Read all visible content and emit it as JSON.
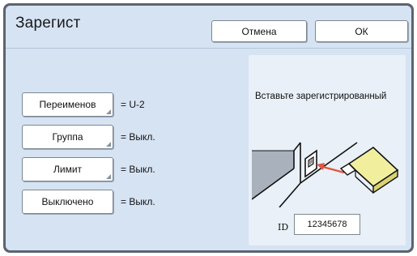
{
  "header": {
    "title": "Зарегист",
    "cancel_label": "Отмена",
    "ok_label": "ОК"
  },
  "settings": [
    {
      "label": "Переименов",
      "value": "= U-2"
    },
    {
      "label": "Группа",
      "value": "= Выкл."
    },
    {
      "label": "Лимит",
      "value": "= Выкл."
    },
    {
      "label": "Выключено",
      "value": "= Выкл."
    }
  ],
  "card": {
    "instruction": "Вставьте зарегистрированный",
    "illustration_icon": "usb-insert-icon",
    "id_label": "ID",
    "id_value": "12345678"
  },
  "colors": {
    "panel_bg": "#d6e3f3",
    "frame": "#5c6470",
    "card_bg": "#e9f0f8",
    "usb_body": "#f1ef9e",
    "arrow": "#e4553b"
  }
}
